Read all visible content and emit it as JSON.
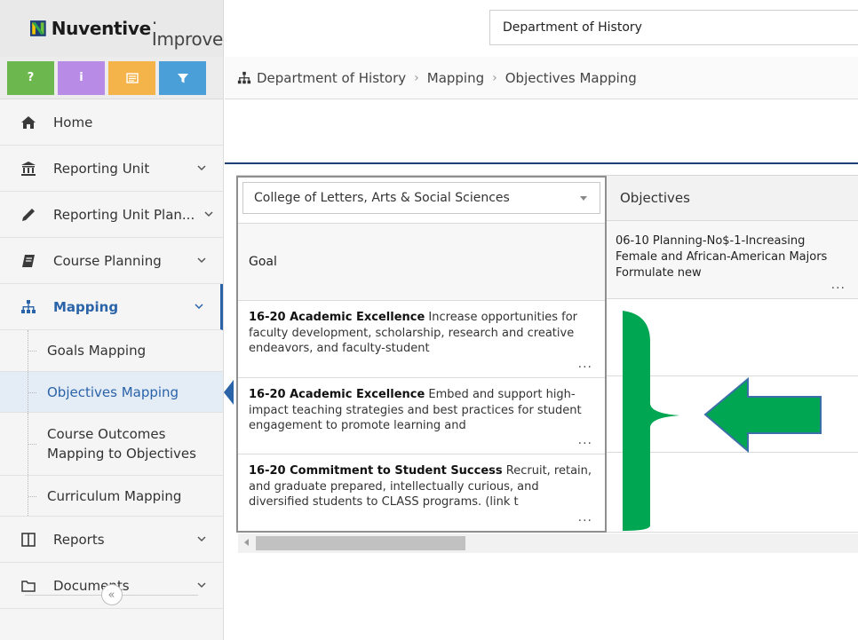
{
  "app": {
    "brand_name": "Nuventive",
    "brand_sub": ". Improve",
    "unit_selector": "Department of History"
  },
  "toolbar": {
    "buttons": [
      {
        "label": "?",
        "color": "#6db74f",
        "icon": "question-icon"
      },
      {
        "label": "i",
        "color": "#b78be6",
        "icon": "info-icon"
      },
      {
        "label": "",
        "color": "#f5b449",
        "icon": "notes-icon"
      },
      {
        "label": "",
        "color": "#4a9fd8",
        "icon": "filter-icon"
      }
    ]
  },
  "sidebar": {
    "items": [
      {
        "label": "Home",
        "icon": "home-icon"
      },
      {
        "label": "Reporting Unit",
        "icon": "institution-icon"
      },
      {
        "label": "Reporting Unit Plan...",
        "icon": "pencil-icon"
      },
      {
        "label": "Course Planning",
        "icon": "book-icon"
      },
      {
        "label": "Mapping",
        "icon": "sitemap-icon",
        "active": true
      },
      {
        "label": "Reports",
        "icon": "columns-icon"
      },
      {
        "label": "Documents",
        "icon": "folder-icon"
      }
    ],
    "mapping_sub": [
      {
        "label": "Goals Mapping"
      },
      {
        "label": "Objectives Mapping",
        "selected": true
      },
      {
        "label": "Course Outcomes Mapping to Objectives"
      },
      {
        "label": "Curriculum Mapping"
      }
    ],
    "collapse_label": "«"
  },
  "breadcrumb": {
    "items": [
      "Department of History",
      "Mapping",
      "Objectives Mapping"
    ],
    "separator": "›"
  },
  "grid": {
    "college_select": "College of Letters, Arts & Social Sciences",
    "objectives_header": "Objectives",
    "goal_header": "Goal",
    "objective_column": {
      "title": "06-10 Planning-No$-1-Increasing Female and African-American Majors",
      "rest": " Formulate new"
    },
    "goals": [
      {
        "title": "16-20 Academic Excellence",
        "text": " Increase opportunities for faculty development, scholarship, research and creative endeavors, and faculty-student"
      },
      {
        "title": "16-20 Academic Excellence",
        "text": " Embed and support high-impact teaching strategies and best practices for student engagement to promote learning and"
      },
      {
        "title": "16-20 Commitment to Student Success",
        "text": " Recruit, retain, and graduate prepared, intellectually curious, and diversified students to CLASS programs. (link t​"
      }
    ],
    "ellipsis": "..."
  },
  "annotation": {
    "bracket_color": "#00a651",
    "arrow_color": "#00a651",
    "arrow_outline": "#3b6fa8"
  }
}
